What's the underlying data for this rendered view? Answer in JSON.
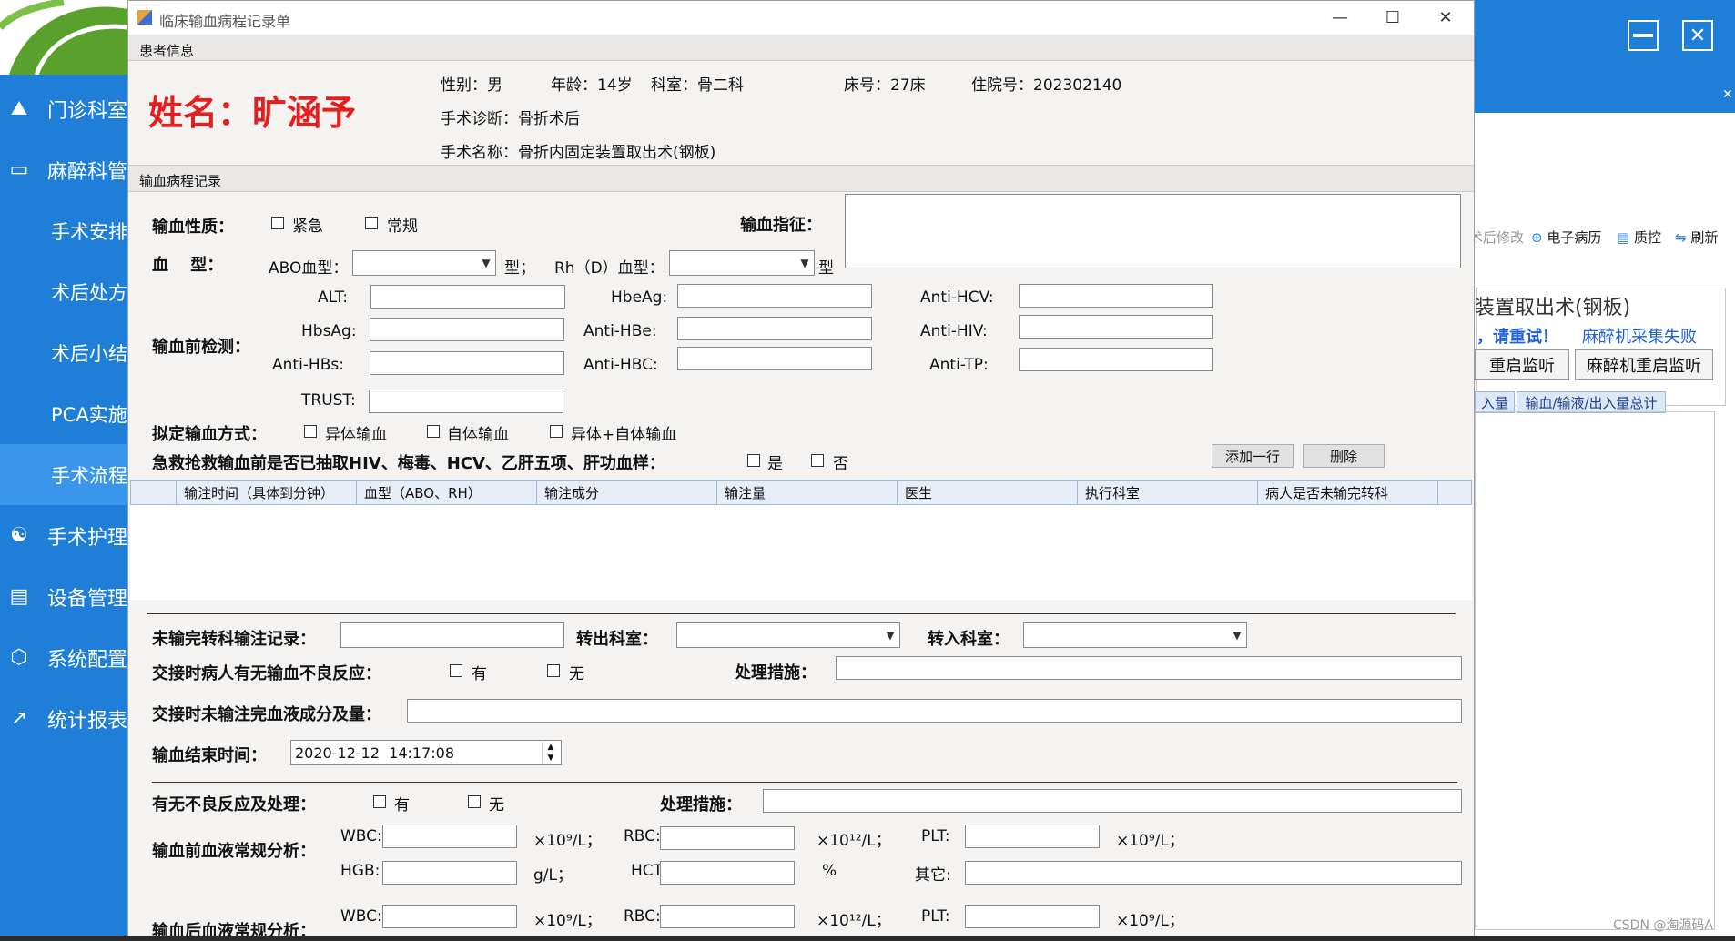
{
  "sidebar": {
    "items": [
      {
        "label": "门诊科室",
        "icon": "flask-icon"
      },
      {
        "label": "麻醉科管",
        "icon": "monitor-icon"
      },
      {
        "label": "手术安排"
      },
      {
        "label": "术后处方"
      },
      {
        "label": "术后小结"
      },
      {
        "label": "PCA实施"
      },
      {
        "label": "手术流程"
      },
      {
        "label": "手术护理",
        "icon": "network-icon"
      },
      {
        "label": "设备管理",
        "icon": "server-icon"
      },
      {
        "label": "系统配置",
        "icon": "cube-icon"
      },
      {
        "label": "统计报表",
        "icon": "chart-icon"
      }
    ]
  },
  "background_app": {
    "toolbar": {
      "after_edit": "术后修改",
      "emr": "电子病历",
      "qc": "质控",
      "refresh": "刷新"
    },
    "surgery_title": "装置取出术(钢板)",
    "retry_msg": "，请重试！",
    "collect_fail": "麻醉机采集失败",
    "restart_monitor": "重启监听",
    "restart_anesthesia": "麻醉机重启监听",
    "tab_in": "入量",
    "tab_summary": "输血/输液/出入量总计",
    "watermark": "CSDN @淘源码A"
  },
  "dialog": {
    "title": "临床输血病程记录单",
    "patient_section": "患者信息",
    "patient": {
      "name": "姓名：旷涵予",
      "gender": "性别：男",
      "age": "年龄：14岁",
      "dept": "科室：骨二科",
      "bed": "床号：27床",
      "admission": "住院号：202302140",
      "diagnosis": "手术诊断：骨折术后",
      "surgery": "手术名称：骨折内固定装置取出术(钢板)"
    },
    "record_section": "输血病程记录",
    "nature_label": "输血性质：",
    "nature_urgent": "紧急",
    "nature_normal": "常规",
    "indication_label": "输血指征：",
    "blood_type_label": "血　 型：",
    "abo_label": "ABO血型：",
    "abo_value": "",
    "type_suffix1": "型；",
    "rh_label": "Rh（D）血型：",
    "rh_value": "",
    "type_suffix2": "型",
    "pre_test_label": "输血前检测：",
    "tests": {
      "alt": "ALT:",
      "hbeag": "HbeAg:",
      "anti_hcv": "Anti-HCV:",
      "hbsag": "HbsAg:",
      "anti_hbe": "Anti-HBe:",
      "anti_hiv": "Anti-HIV:",
      "anti_hbs": "Anti-HBs:",
      "anti_hbc": "Anti-HBC:",
      "anti_tp": "Anti-TP:",
      "trust": "TRUST:"
    },
    "method_label": "拟定输血方式：",
    "method_allo": "异体输血",
    "method_auto": "自体输血",
    "method_both": "异体+自体输血",
    "emergency_q": "急救抢救输血前是否已抽取HIV、梅毒、HCV、乙肝五项、肝功血样：",
    "yes": "是",
    "no": "否",
    "add_row": "添加一行",
    "delete": "删除",
    "grid_cols": [
      "输注时间（具体到分钟）",
      "血型（ABO、RH）",
      "输注成分",
      "输注量",
      "医生",
      "执行科室",
      "病人是否未输完转科"
    ],
    "transfer_record_label": "未输完转科输注记录：",
    "out_dept_label": "转出科室：",
    "in_dept_label": "转入科室：",
    "handover_reaction_label": "交接时病人有无输血不良反应：",
    "has": "有",
    "none": "无",
    "measures_label": "处理措施：",
    "handover_remaining_label": "交接时未输注完血液成分及量：",
    "end_time_label": "输血结束时间：",
    "end_time_value": "2020-12-12  14:17:08",
    "adverse_label": "有无不良反应及处理：",
    "adverse_has": "有",
    "adverse_none": "无",
    "adverse_measures_label": "处理措施：",
    "pre_routine_label": "输血前血液常规分析：",
    "post_routine_label": "输血后血液常规分析：",
    "wbc": "WBC:",
    "rbc": "RBC:",
    "plt": "PLT:",
    "hgb": "HGB:",
    "hct": "HCT",
    "other": "其它:",
    "unit_109": "×10⁹/L；",
    "unit_1012": "×10¹²/L；",
    "unit_gl": "g/L；",
    "unit_pct": "%"
  }
}
